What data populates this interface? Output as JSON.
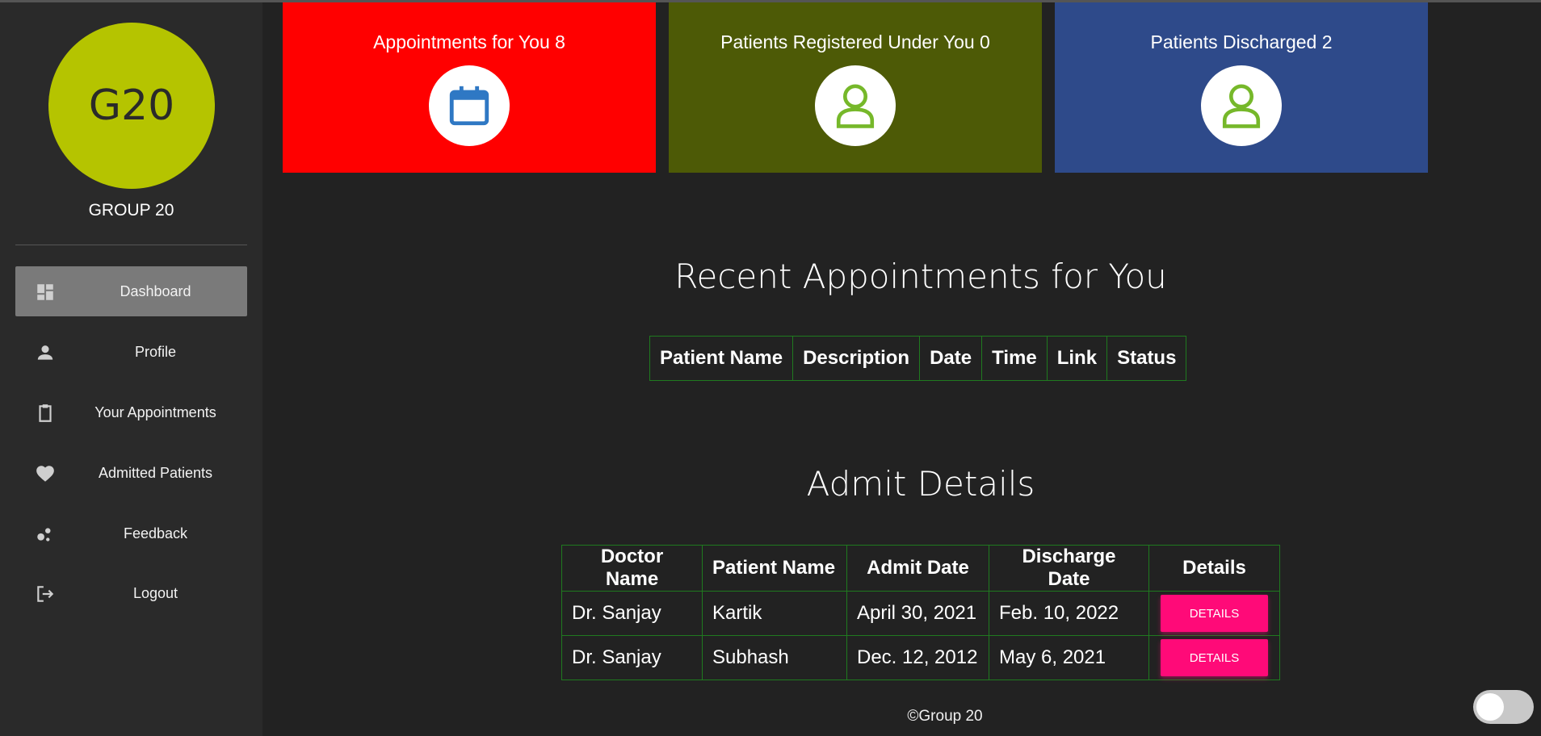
{
  "sidebar": {
    "avatar_text": "G20",
    "group_name": "GROUP 20",
    "items": [
      {
        "label": "Dashboard",
        "icon": "dashboard-icon"
      },
      {
        "label": "Profile",
        "icon": "person-icon"
      },
      {
        "label": "Your Appointments",
        "icon": "clipboard-icon"
      },
      {
        "label": "Admitted Patients",
        "icon": "heart-icon"
      },
      {
        "label": "Feedback",
        "icon": "bubbles-icon"
      },
      {
        "label": "Logout",
        "icon": "logout-icon"
      }
    ]
  },
  "cards": [
    {
      "title": "Appointments for You 8",
      "icon": "calendar-icon",
      "color": "#ff0000"
    },
    {
      "title": "Patients Registered Under You 0",
      "icon": "user-icon",
      "color": "#4d5a06"
    },
    {
      "title": "Patients Discharged 2",
      "icon": "user-icon",
      "color": "#2e4a8a"
    }
  ],
  "appointments": {
    "title": "Recent Appointments for You",
    "headers": [
      "Patient Name",
      "Description",
      "Date",
      "Time",
      "Link",
      "Status"
    ]
  },
  "admit": {
    "title": "Admit Details",
    "headers": [
      "Doctor Name",
      "Patient Name",
      "Admit Date",
      "Discharge Date",
      "Details"
    ],
    "rows": [
      {
        "doctor": "Dr. Sanjay",
        "patient": "Kartik",
        "admit": "April 30, 2021",
        "discharge": "Feb. 10, 2022",
        "button": "DETAILS"
      },
      {
        "doctor": "Dr. Sanjay",
        "patient": "Subhash",
        "admit": "Dec. 12, 2012",
        "discharge": "May 6, 2021",
        "button": "DETAILS"
      }
    ]
  },
  "footer": "©Group 20",
  "colors": {
    "accent": "#ff0a78",
    "avatar": "#b5c400",
    "table_border": "#1f7a1f",
    "icon_green": "#76b82a",
    "icon_blue": "#2f78c4"
  }
}
